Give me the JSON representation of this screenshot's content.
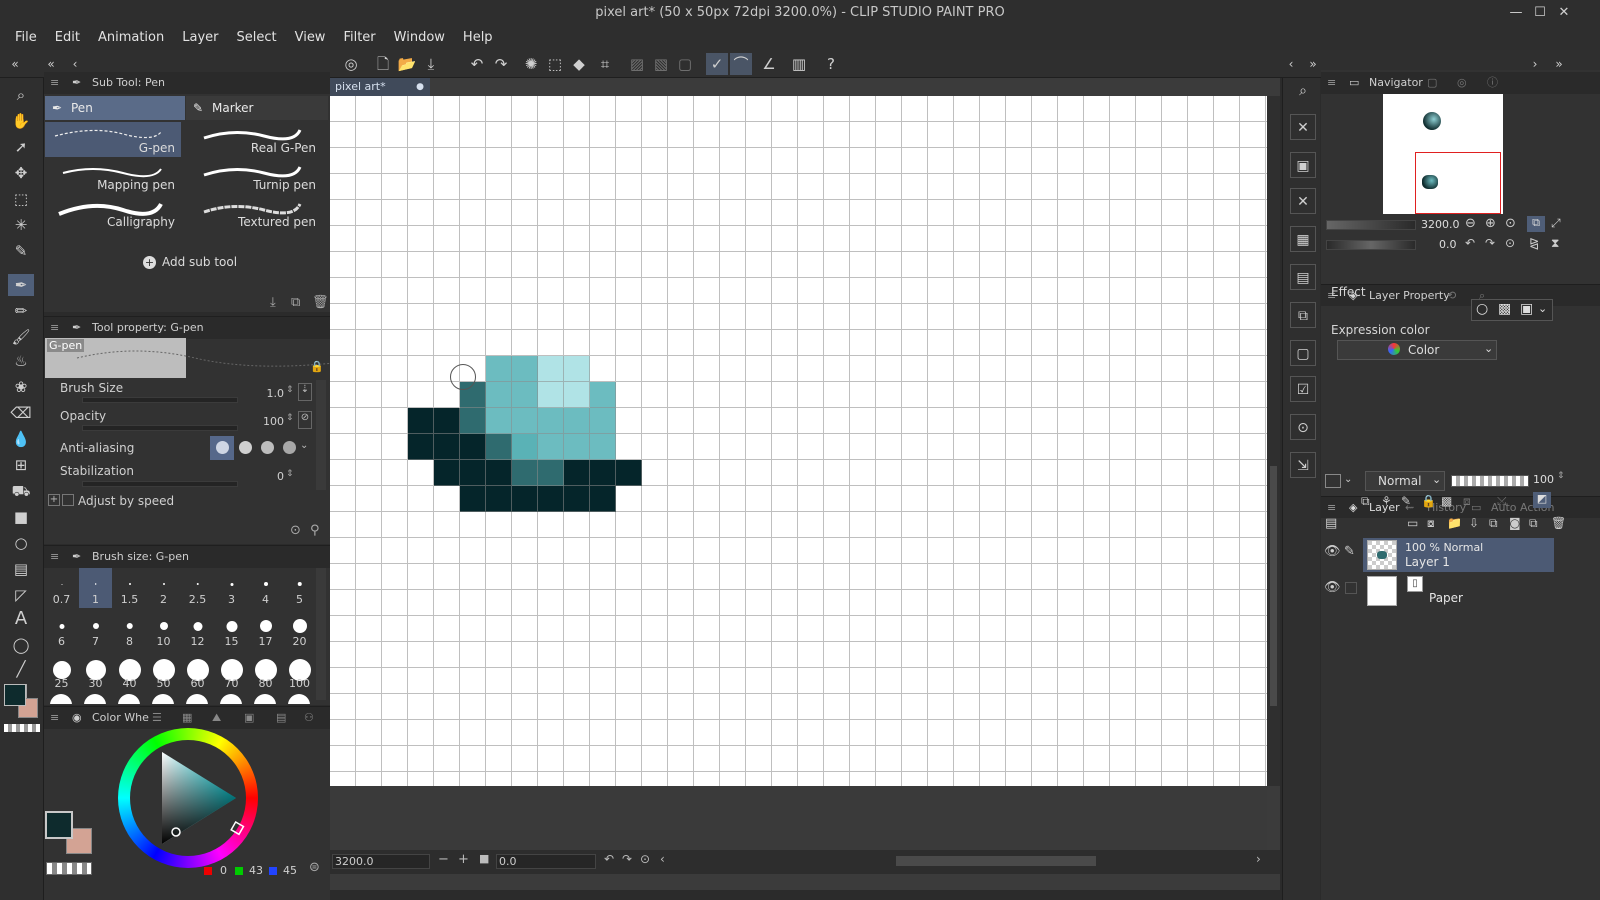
{
  "window": {
    "title": "pixel art* (50 x 50px 72dpi 3200.0%) - CLIP STUDIO PAINT PRO"
  },
  "menu": [
    "File",
    "Edit",
    "Animation",
    "Layer",
    "Select",
    "View",
    "Filter",
    "Window",
    "Help"
  ],
  "subtool": {
    "header": "Sub Tool: Pen",
    "tabs": [
      "Pen",
      "Marker"
    ],
    "brushes": [
      "G-pen",
      "Real G-Pen",
      "Mapping pen",
      "Turnip pen",
      "Calligraphy",
      "Textured pen"
    ],
    "add_label": "Add sub tool"
  },
  "toolprop": {
    "header": "Tool property: G-pen",
    "preview_label": "G-pen",
    "brush_size_label": "Brush Size",
    "brush_size_value": "1.0",
    "opacity_label": "Opacity",
    "opacity_value": "100",
    "antialias_label": "Anti-aliasing",
    "stabilization_label": "Stabilization",
    "stabilization_value": "0",
    "adjust_label": "Adjust by speed"
  },
  "brushsize": {
    "header": "Brush size: G-pen",
    "sizes": [
      "0.7",
      "1",
      "1.5",
      "2",
      "2.5",
      "3",
      "4",
      "5",
      "6",
      "7",
      "8",
      "10",
      "12",
      "15",
      "17",
      "20",
      "25",
      "30",
      "40",
      "50",
      "60",
      "70",
      "80",
      "100"
    ]
  },
  "colorwheel": {
    "header": "Color Whe",
    "rgb": {
      "r": "0",
      "g": "43",
      "b": "45"
    },
    "main_color": "#0e2b2d",
    "sub_color": "#d3a394"
  },
  "document": {
    "tab_label": "pixel art*",
    "zoom_value": "3200.0",
    "angle_value": "0.0"
  },
  "navigator": {
    "header": "Navigator",
    "zoom": "3200.0",
    "angle": "0.0"
  },
  "layerprop": {
    "header": "Layer Property",
    "effect_label": "Effect",
    "expression_label": "Expression color",
    "expression_value": "Color"
  },
  "layers": {
    "tabs": [
      "Layer",
      "History",
      "Auto Action"
    ],
    "blend_mode": "Normal",
    "opacity": "100",
    "items": [
      {
        "line1": "100 % Normal",
        "line2": "Layer 1"
      },
      {
        "line1": "",
        "line2": "Paper"
      }
    ]
  },
  "pixels": {
    "palette": {
      "a": "#b0e3e6",
      "b": "#6cbcc0",
      "c": "#5ab2b6",
      "d": "#2f6b6f",
      "e": "#0e2b2d",
      "f": "#05252a"
    },
    "rows": [
      {
        "r": 10,
        "c": 6,
        "cells": "bbaa"
      },
      {
        "r": 11,
        "c": 5,
        "cells": "dbbaab"
      },
      {
        "r": 12,
        "c": 3,
        "cells": "ffdbbbbb"
      },
      {
        "r": 13,
        "c": 3,
        "cells": "fffdcbbb"
      },
      {
        "r": 14,
        "c": 4,
        "cells": "fffddfff"
      },
      {
        "r": 15,
        "c": 5,
        "cells": "ffffff"
      }
    ]
  }
}
